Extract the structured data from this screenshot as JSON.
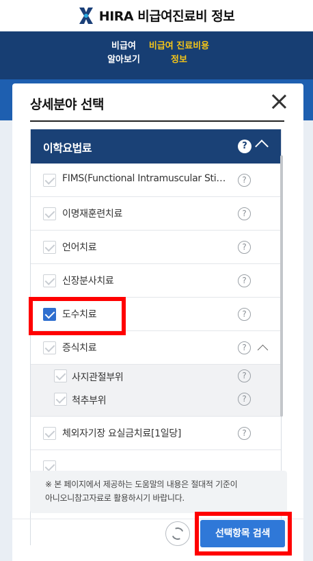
{
  "header": {
    "title": "HIRA 비급여진료비 정보",
    "logo_icon": "hira-logo-icon"
  },
  "nav": {
    "item1_line1": "비급여",
    "item1_line2": "알아보기",
    "item2_line1": "비급여 진료비용",
    "item2_line2": "정보"
  },
  "modal": {
    "title": "상세분야 선택",
    "category": {
      "title": "이학요법료",
      "help": "?"
    },
    "items": [
      {
        "label": "FIMS(Functional Intramuscular Stimul…",
        "checked": false
      },
      {
        "label": "이명재훈련치료",
        "checked": false
      },
      {
        "label": "언어치료",
        "checked": false
      },
      {
        "label": "신장분사치료",
        "checked": false
      },
      {
        "label": "도수치료",
        "checked": true
      },
      {
        "label": "증식치료",
        "checked": false
      },
      {
        "label": "체외자기장 요실금치료[1일당]",
        "checked": false
      }
    ],
    "sub_items": [
      {
        "label": "사지관절부위",
        "checked": false
      },
      {
        "label": "척추부위",
        "checked": false
      }
    ],
    "help_mark": "?",
    "notice_line1": "※ 본 페이지에서 제공하는 도움말의 내용은 절대적 기준이",
    "notice_line2": "아니오니참고자료로 활용하시기 바랍니다.",
    "search_button": "선택항목 검색"
  },
  "colors": {
    "navy": "#173e73",
    "accent_yellow": "#f5c518",
    "button_blue": "#2f78d8",
    "highlight_red": "#ff0000"
  }
}
